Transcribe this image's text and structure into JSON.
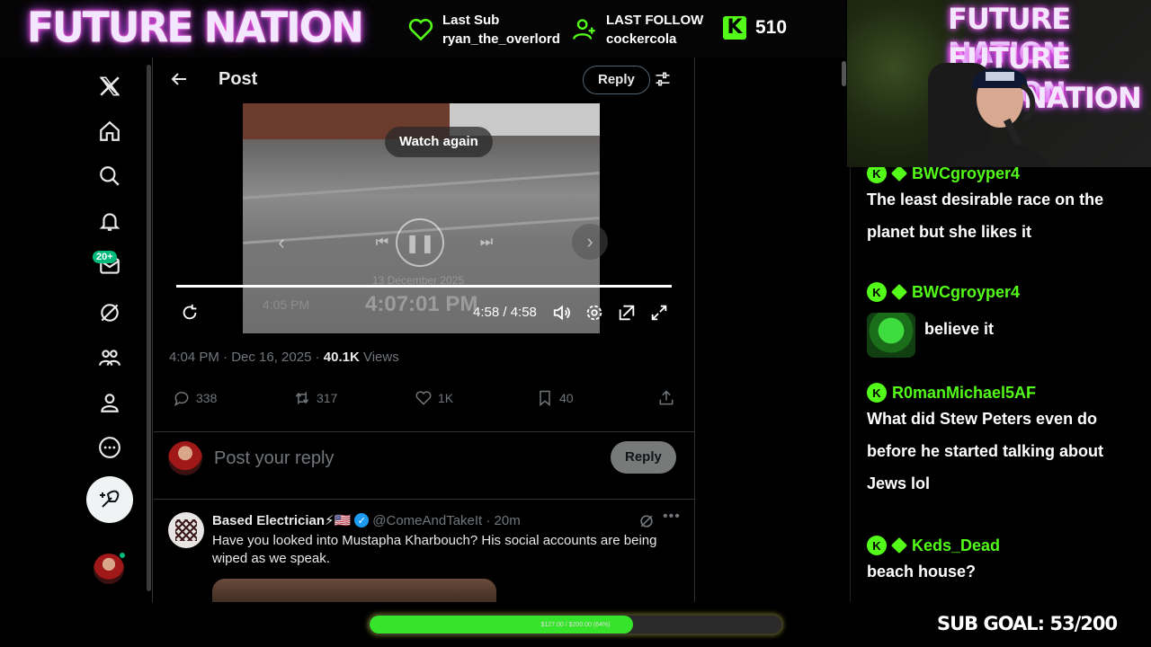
{
  "overlay": {
    "brand": "FUTURE NATION",
    "last_sub_label": "Last Sub",
    "last_sub_value": "ryan_the_overlord",
    "last_follow_label": "LAST FOLLOW",
    "last_follow_value": "cockercola",
    "kick_badge": "K",
    "kick_count": "510",
    "webcam_neon_1": "FUTURE NATION",
    "webcam_neon_2": "FUTURE NATION",
    "webcam_neon_3": "NATION",
    "goal_bar_text": "$127.00 / $200.00 (64%)",
    "goal_progress_fraction": 0.64,
    "sub_goal": "SUB GOAL: 53/200",
    "colors": {
      "kick_green": "#53fc18",
      "goal_fill": "#36e42b"
    }
  },
  "sidebar": {
    "items": [
      {
        "name": "x-logo-icon"
      },
      {
        "name": "home-icon"
      },
      {
        "name": "search-icon"
      },
      {
        "name": "bell-icon"
      },
      {
        "name": "mail-icon"
      },
      {
        "name": "grok-icon"
      },
      {
        "name": "communities-icon"
      },
      {
        "name": "profile-icon"
      },
      {
        "name": "more-icon"
      }
    ],
    "messages_badge": "20+"
  },
  "post": {
    "title": "Post",
    "reply_button": "Reply",
    "video": {
      "watch_again": "Watch again",
      "time": "4:58 / 4:58",
      "progress_fraction": 1.0,
      "overlay_date": "13 December 2025",
      "overlay_time": "4:07:01 PM",
      "overlay_time_small": "4:05 PM"
    },
    "meta_time": "4:04 PM · Dec 16, 2025 · ",
    "meta_views_count": "40.1K",
    "meta_views_label": " Views",
    "stats": {
      "replies": "338",
      "reposts": "317",
      "likes": "1K",
      "bookmarks": "40"
    },
    "reply_placeholder": "Post your reply",
    "reply_submit": "Reply"
  },
  "comment": {
    "name": "Based Electrician⚡🇺🇸",
    "handle": "@ComeAndTakeIt · 20m",
    "text": "Have you looked into Mustapha Kharbouch? His social accounts are being wiped as we speak."
  },
  "chat": {
    "messages": [
      {
        "user": "BWCgroyper4",
        "text1": "The least desirable race on the",
        "text2": "planet but she likes it"
      },
      {
        "user": "BWCgroyper4",
        "text1": "believe it"
      },
      {
        "user": "R0manMichael5AF",
        "text1": "What did Stew Peters even do",
        "text2": "before he started talking about",
        "text3": "Jews lol"
      },
      {
        "user": "Keds_Dead",
        "text1": "beach house?"
      }
    ]
  }
}
